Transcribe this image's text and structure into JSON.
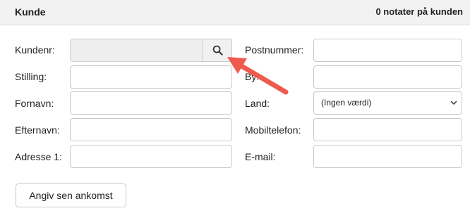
{
  "header": {
    "title": "Kunde",
    "notes": "0 notater på kunden"
  },
  "form": {
    "left": {
      "customer_no_label": "Kundenr:",
      "customer_no_value": "",
      "position_label": "Stilling:",
      "position_value": "",
      "first_name_label": "Fornavn:",
      "first_name_value": "",
      "last_name_label": "Efternavn:",
      "last_name_value": "",
      "address1_label": "Adresse 1:",
      "address1_value": ""
    },
    "right": {
      "postal_label": "Postnummer:",
      "postal_value": "",
      "city_label": "By:",
      "city_value": "",
      "country_label": "Land:",
      "country_selected": "(Ingen værdi)",
      "mobile_label": "Mobiltelefon:",
      "mobile_value": "",
      "email_label": "E-mail:",
      "email_value": ""
    }
  },
  "actions": {
    "late_arrival_label": "Angiv sen ankomst"
  },
  "icons": {
    "search": "search-icon",
    "dropdown": "chevron-down-icon",
    "annotation": "arrow-icon"
  },
  "colors": {
    "arrow": "#ef5a4f"
  }
}
